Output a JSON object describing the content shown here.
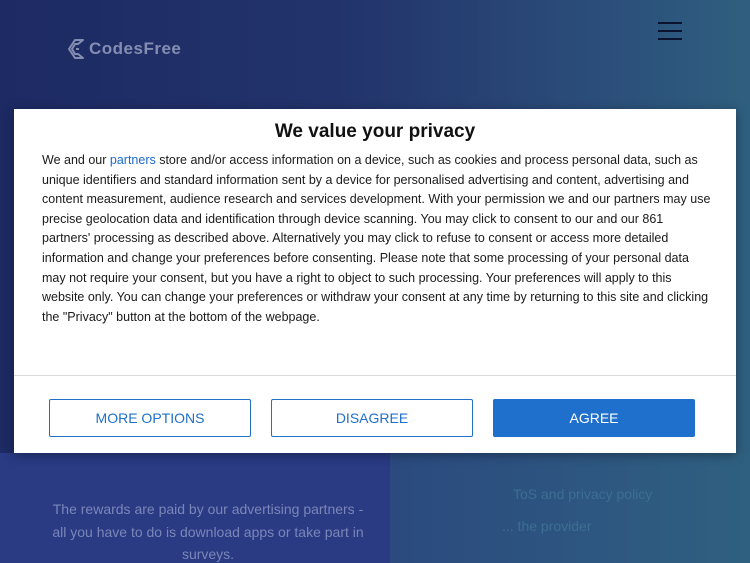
{
  "site": {
    "logo_text": "CodesFree",
    "rewards_text": "The rewards are paid by our advertising partners - all you have to do is download apps or take part in surveys.",
    "tos_text": "ToS and privacy policy",
    "provider_text": "... the provider"
  },
  "consent": {
    "title": "We value your privacy",
    "body_before_link": "We and our ",
    "link_text": "partners",
    "body_after_link": " store and/or access information on a device, such as cookies and process personal data, such as unique identifiers and standard information sent by a device for personalised advertising and content, advertising and content measurement, audience research and services development. With your permission we and our partners may use precise geolocation data and identification through device scanning. You may click to consent to our and our 861 partners' processing as described above. Alternatively you may click to refuse to consent or access more detailed information and change your preferences before consenting. Please note that some processing of your personal data may not require your consent, but you have a right to object to such processing. Your preferences will apply to this website only. You can change your preferences or withdraw your consent at any time by returning to this site and clicking the \"Privacy\" button at the bottom of the webpage.",
    "buttons": {
      "more_options": "MORE OPTIONS",
      "disagree": "DISAGREE",
      "agree": "AGREE"
    }
  },
  "colors": {
    "accent": "#1f6fcc",
    "background": "#22336b"
  }
}
